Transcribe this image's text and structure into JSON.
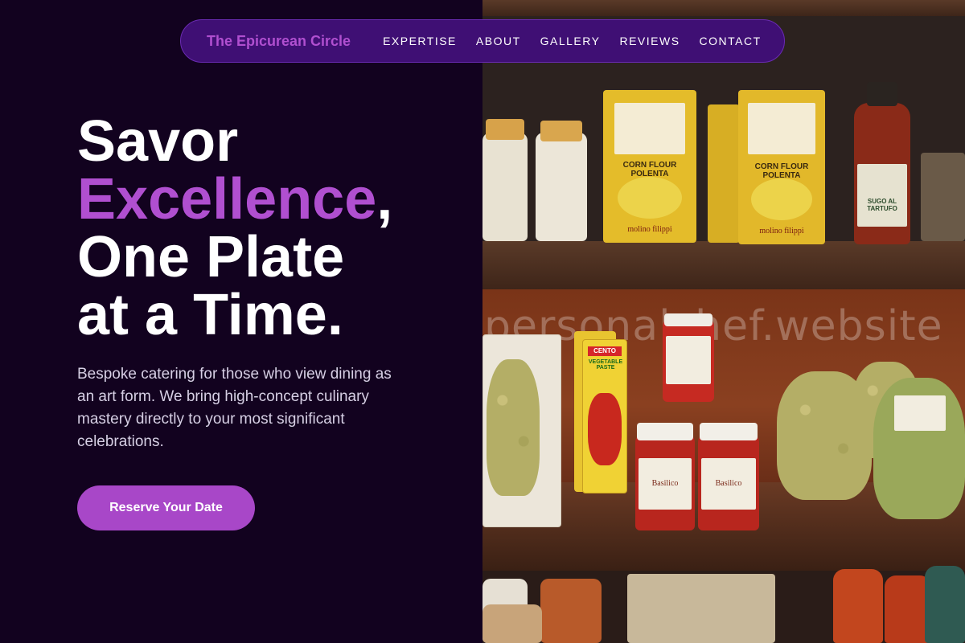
{
  "nav": {
    "brand": "The Epicurean Circle",
    "links": [
      "EXPERTISE",
      "ABOUT",
      "GALLERY",
      "REVIEWS",
      "CONTACT"
    ]
  },
  "hero": {
    "line1": "Savor",
    "line2_accent": "Excellence",
    "line2_rest": ",",
    "line3": "One Plate",
    "line4": "at a Time.",
    "description": "Bespoke catering for those who view dining as an art form. We bring high-concept culinary mastery directly to your most significant celebrations.",
    "cta": "Reserve Your Date"
  },
  "image": {
    "watermark": "personalchef.website",
    "labels": {
      "polenta": "CORN FLOUR POLENTA",
      "polenta_brand": "molino filippi",
      "tartufo": "SUGO AL TARTUFO",
      "paste": "VEGETABLE PASTE",
      "paste_brand": "CENTO",
      "basilico": "Basilico"
    }
  },
  "colors": {
    "background": "#12021f",
    "accent": "#b04fd0",
    "nav_bg": "#3f0f74",
    "cta_bg": "#a847c8"
  }
}
